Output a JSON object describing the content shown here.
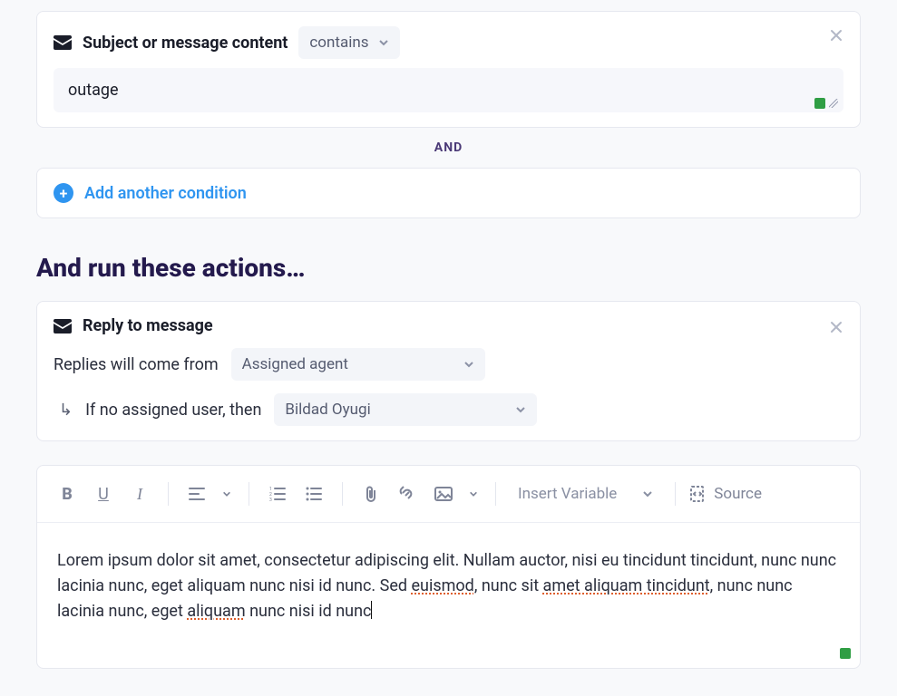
{
  "condition": {
    "title": "Subject or message content",
    "operator": "contains",
    "value": "outage"
  },
  "separator": "AND",
  "add_condition_label": "Add another condition",
  "section_heading": "And run these actions…",
  "action": {
    "title": "Reply to message",
    "replies_from_label": "Replies will come from",
    "replies_from_value": "Assigned agent",
    "fallback_label": "If no assigned user, then",
    "fallback_value": "Bildad Oyugi"
  },
  "editor": {
    "insert_variable_label": "Insert Variable",
    "source_label": "Source",
    "body_plain_pre": "Lorem ipsum dolor sit amet, consectetur adipiscing elit. Nullam auctor, nisi eu tincidunt tincidunt, nunc nunc lacinia nunc, eget aliquam nunc nisi id nunc. Sed ",
    "spell1": "euismod",
    "body_mid1": ", nunc sit ",
    "spell2": "amet aliquam tincidunt",
    "body_mid2": ", nunc nunc lacinia nunc, eget ",
    "spell3": "aliquam",
    "body_end": " nunc nisi id nunc"
  },
  "icons": {
    "bold": "B",
    "underline": "U",
    "italic": "I"
  }
}
